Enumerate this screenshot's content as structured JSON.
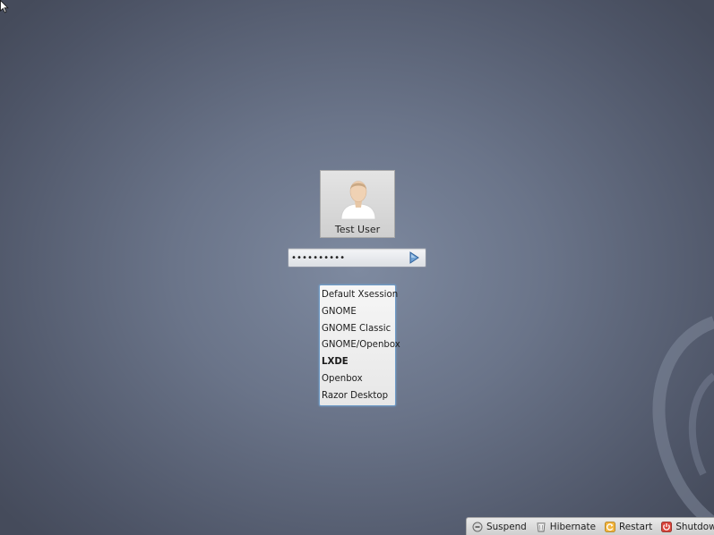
{
  "user": {
    "name": "Test User"
  },
  "password": {
    "masked_value": "••••••••••"
  },
  "sessions": [
    {
      "label": "Default Xsession",
      "bold": false
    },
    {
      "label": "GNOME",
      "bold": false
    },
    {
      "label": "GNOME Classic",
      "bold": false
    },
    {
      "label": "GNOME/Openbox",
      "bold": false
    },
    {
      "label": "LXDE",
      "bold": true
    },
    {
      "label": "Openbox",
      "bold": false
    },
    {
      "label": "Razor Desktop",
      "bold": false
    }
  ],
  "power": {
    "suspend": "Suspend",
    "hibernate": "Hibernate",
    "restart": "Restart",
    "shutdown": "Shutdown"
  },
  "icons": {
    "avatar": "user-avatar-icon",
    "submit": "arrow-right-icon",
    "suspend": "suspend-icon",
    "hibernate": "hibernate-icon",
    "restart": "restart-icon",
    "shutdown": "power-icon"
  }
}
